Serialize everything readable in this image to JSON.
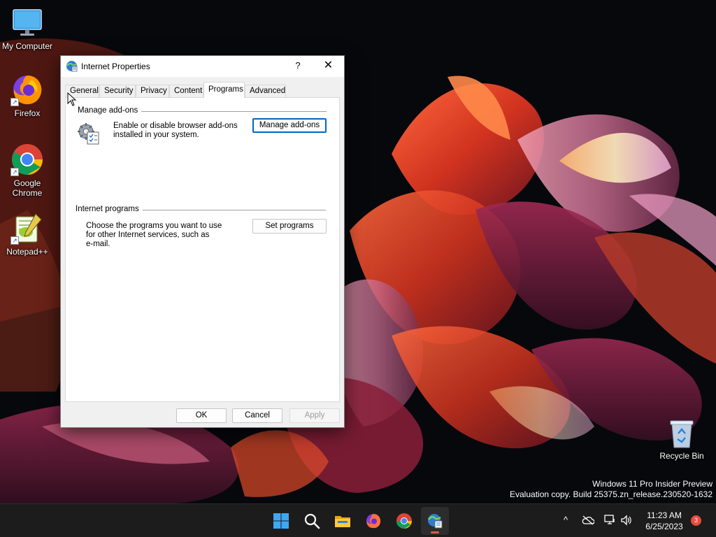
{
  "desktop": {
    "icons": [
      {
        "label": "My Computer"
      },
      {
        "label": "Firefox"
      },
      {
        "label": "Google Chrome"
      },
      {
        "label": "Notepad++"
      },
      {
        "label": "Recycle Bin"
      }
    ],
    "watermark": {
      "line1": "Windows 11 Pro Insider Preview",
      "line2": "Evaluation copy. Build 25375.zn_release.230520-1632"
    }
  },
  "dialog": {
    "title": "Internet Properties",
    "help_label": "?",
    "close_label": "✕",
    "tabs": [
      {
        "label": "General",
        "active": false
      },
      {
        "label": "Security",
        "active": false
      },
      {
        "label": "Privacy",
        "active": false
      },
      {
        "label": "Content",
        "active": false
      },
      {
        "label": "Programs",
        "active": true
      },
      {
        "label": "Advanced",
        "active": false
      }
    ],
    "manage_addons": {
      "group_label": "Manage add-ons",
      "desc_line1": "Enable or disable browser add-ons",
      "desc_line2": "installed in your system.",
      "button_label": "Manage add-ons"
    },
    "internet_programs": {
      "group_label": "Internet programs",
      "desc_line1": "Choose the programs you want to use",
      "desc_line2": "for other Internet services, such as",
      "desc_line3": "e-mail.",
      "button_label": "Set programs"
    },
    "footer": {
      "ok_label": "OK",
      "cancel_label": "Cancel",
      "apply_label": "Apply"
    }
  },
  "taskbar": {
    "apps": [
      "start-button",
      "search-button",
      "file-explorer",
      "firefox",
      "chrome",
      "internet-properties"
    ],
    "clock_time": "11:23 AM",
    "clock_date": "6/25/2023",
    "notification_count": "3",
    "tray_chevron": "^"
  },
  "colors": {
    "accent": "#0067c0",
    "taskbar": "#1c1c1c",
    "indicator": "#e25b4b"
  }
}
